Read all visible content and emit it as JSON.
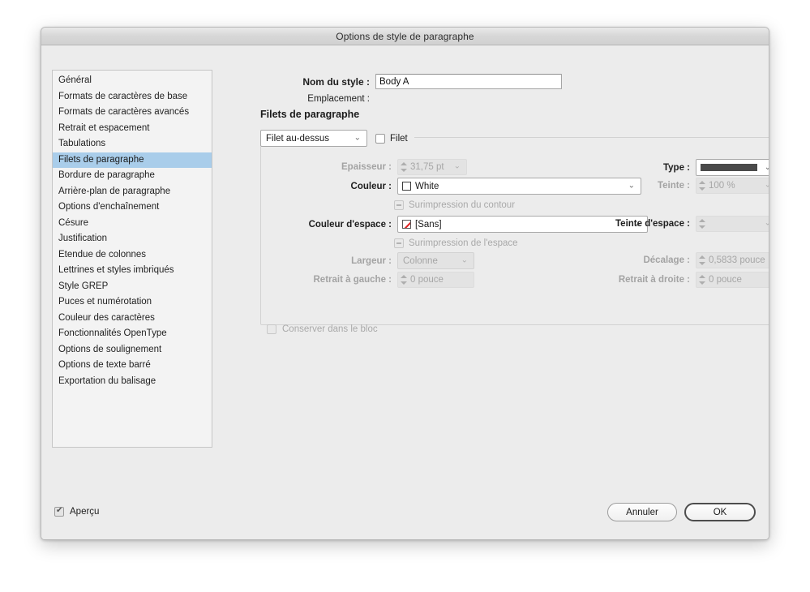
{
  "window": {
    "title": "Options de style de paragraphe"
  },
  "sidebar": {
    "items": [
      {
        "label": "Général",
        "selected": false
      },
      {
        "label": "Formats de caractères de base",
        "selected": false
      },
      {
        "label": "Formats de caractères avancés",
        "selected": false
      },
      {
        "label": "Retrait et espacement",
        "selected": false
      },
      {
        "label": "Tabulations",
        "selected": false
      },
      {
        "label": "Filets de paragraphe",
        "selected": true
      },
      {
        "label": "Bordure de paragraphe",
        "selected": false
      },
      {
        "label": "Arrière-plan de paragraphe",
        "selected": false
      },
      {
        "label": "Options d'enchaînement",
        "selected": false
      },
      {
        "label": "Césure",
        "selected": false
      },
      {
        "label": "Justification",
        "selected": false
      },
      {
        "label": "Etendue de colonnes",
        "selected": false
      },
      {
        "label": "Lettrines et styles imbriqués",
        "selected": false
      },
      {
        "label": "Style GREP",
        "selected": false
      },
      {
        "label": "Puces et numérotation",
        "selected": false
      },
      {
        "label": "Couleur des caractères",
        "selected": false
      },
      {
        "label": "Fonctionnalités OpenType",
        "selected": false
      },
      {
        "label": "Options de soulignement",
        "selected": false
      },
      {
        "label": "Options de texte barré",
        "selected": false
      },
      {
        "label": "Exportation du balisage",
        "selected": false
      }
    ]
  },
  "header": {
    "style_name_label": "Nom du style :",
    "style_name_value": "Body A",
    "location_label": "Emplacement :",
    "location_value": ""
  },
  "main": {
    "section_title": "Filets de paragraphe",
    "rule_position_value": "Filet au-dessus",
    "rule_enable_label": "Filet",
    "rule_enable_checked": false,
    "fields": {
      "weight_label": "Epaisseur :",
      "weight_value": "31,75 pt",
      "type_label": "Type :",
      "color_label": "Couleur :",
      "color_value": "White",
      "tint_label": "Teinte :",
      "tint_value": "100 %",
      "overprint_stroke_label": "Surimpression du contour",
      "gap_color_label": "Couleur d'espace :",
      "gap_color_value": "[Sans]",
      "gap_tint_label": "Teinte d'espace :",
      "gap_tint_value": "",
      "overprint_gap_label": "Surimpression de l'espace",
      "width_label": "Largeur :",
      "width_value": "Colonne",
      "offset_label": "Décalage :",
      "offset_value": "0,5833 pouce",
      "left_indent_label": "Retrait à gauche :",
      "left_indent_value": "0 pouce",
      "right_indent_label": "Retrait à droite :",
      "right_indent_value": "0 pouce",
      "keep_in_frame_label": "Conserver dans le bloc",
      "keep_in_frame_checked": false
    }
  },
  "footer": {
    "preview_label": "Aperçu",
    "preview_checked": true,
    "cancel_label": "Annuler",
    "ok_label": "OK"
  },
  "colors": {
    "selection": "#a9cdea",
    "window_bg": "#ececec",
    "titlebar": "#d7d7d7",
    "none_swatch_slash": "#e02020",
    "rule_type_line": "#4a4a4a"
  }
}
